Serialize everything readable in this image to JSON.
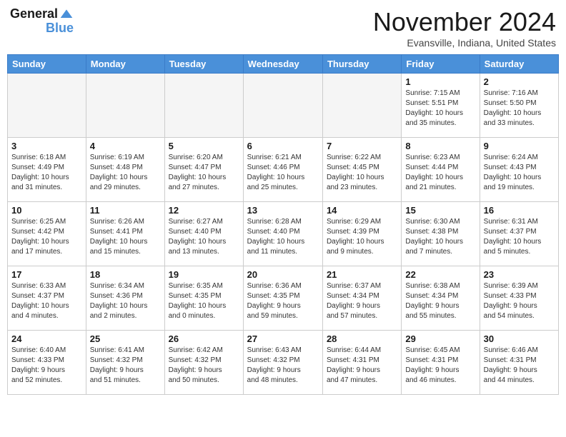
{
  "logo": {
    "line1": "General",
    "line2": "Blue"
  },
  "title": "November 2024",
  "location": "Evansville, Indiana, United States",
  "days_of_week": [
    "Sunday",
    "Monday",
    "Tuesday",
    "Wednesday",
    "Thursday",
    "Friday",
    "Saturday"
  ],
  "weeks": [
    [
      {
        "day": "",
        "info": ""
      },
      {
        "day": "",
        "info": ""
      },
      {
        "day": "",
        "info": ""
      },
      {
        "day": "",
        "info": ""
      },
      {
        "day": "",
        "info": ""
      },
      {
        "day": "1",
        "info": "Sunrise: 7:15 AM\nSunset: 5:51 PM\nDaylight: 10 hours\nand 35 minutes."
      },
      {
        "day": "2",
        "info": "Sunrise: 7:16 AM\nSunset: 5:50 PM\nDaylight: 10 hours\nand 33 minutes."
      }
    ],
    [
      {
        "day": "3",
        "info": "Sunrise: 6:18 AM\nSunset: 4:49 PM\nDaylight: 10 hours\nand 31 minutes."
      },
      {
        "day": "4",
        "info": "Sunrise: 6:19 AM\nSunset: 4:48 PM\nDaylight: 10 hours\nand 29 minutes."
      },
      {
        "day": "5",
        "info": "Sunrise: 6:20 AM\nSunset: 4:47 PM\nDaylight: 10 hours\nand 27 minutes."
      },
      {
        "day": "6",
        "info": "Sunrise: 6:21 AM\nSunset: 4:46 PM\nDaylight: 10 hours\nand 25 minutes."
      },
      {
        "day": "7",
        "info": "Sunrise: 6:22 AM\nSunset: 4:45 PM\nDaylight: 10 hours\nand 23 minutes."
      },
      {
        "day": "8",
        "info": "Sunrise: 6:23 AM\nSunset: 4:44 PM\nDaylight: 10 hours\nand 21 minutes."
      },
      {
        "day": "9",
        "info": "Sunrise: 6:24 AM\nSunset: 4:43 PM\nDaylight: 10 hours\nand 19 minutes."
      }
    ],
    [
      {
        "day": "10",
        "info": "Sunrise: 6:25 AM\nSunset: 4:42 PM\nDaylight: 10 hours\nand 17 minutes."
      },
      {
        "day": "11",
        "info": "Sunrise: 6:26 AM\nSunset: 4:41 PM\nDaylight: 10 hours\nand 15 minutes."
      },
      {
        "day": "12",
        "info": "Sunrise: 6:27 AM\nSunset: 4:40 PM\nDaylight: 10 hours\nand 13 minutes."
      },
      {
        "day": "13",
        "info": "Sunrise: 6:28 AM\nSunset: 4:40 PM\nDaylight: 10 hours\nand 11 minutes."
      },
      {
        "day": "14",
        "info": "Sunrise: 6:29 AM\nSunset: 4:39 PM\nDaylight: 10 hours\nand 9 minutes."
      },
      {
        "day": "15",
        "info": "Sunrise: 6:30 AM\nSunset: 4:38 PM\nDaylight: 10 hours\nand 7 minutes."
      },
      {
        "day": "16",
        "info": "Sunrise: 6:31 AM\nSunset: 4:37 PM\nDaylight: 10 hours\nand 5 minutes."
      }
    ],
    [
      {
        "day": "17",
        "info": "Sunrise: 6:33 AM\nSunset: 4:37 PM\nDaylight: 10 hours\nand 4 minutes."
      },
      {
        "day": "18",
        "info": "Sunrise: 6:34 AM\nSunset: 4:36 PM\nDaylight: 10 hours\nand 2 minutes."
      },
      {
        "day": "19",
        "info": "Sunrise: 6:35 AM\nSunset: 4:35 PM\nDaylight: 10 hours\nand 0 minutes."
      },
      {
        "day": "20",
        "info": "Sunrise: 6:36 AM\nSunset: 4:35 PM\nDaylight: 9 hours\nand 59 minutes."
      },
      {
        "day": "21",
        "info": "Sunrise: 6:37 AM\nSunset: 4:34 PM\nDaylight: 9 hours\nand 57 minutes."
      },
      {
        "day": "22",
        "info": "Sunrise: 6:38 AM\nSunset: 4:34 PM\nDaylight: 9 hours\nand 55 minutes."
      },
      {
        "day": "23",
        "info": "Sunrise: 6:39 AM\nSunset: 4:33 PM\nDaylight: 9 hours\nand 54 minutes."
      }
    ],
    [
      {
        "day": "24",
        "info": "Sunrise: 6:40 AM\nSunset: 4:33 PM\nDaylight: 9 hours\nand 52 minutes."
      },
      {
        "day": "25",
        "info": "Sunrise: 6:41 AM\nSunset: 4:32 PM\nDaylight: 9 hours\nand 51 minutes."
      },
      {
        "day": "26",
        "info": "Sunrise: 6:42 AM\nSunset: 4:32 PM\nDaylight: 9 hours\nand 50 minutes."
      },
      {
        "day": "27",
        "info": "Sunrise: 6:43 AM\nSunset: 4:32 PM\nDaylight: 9 hours\nand 48 minutes."
      },
      {
        "day": "28",
        "info": "Sunrise: 6:44 AM\nSunset: 4:31 PM\nDaylight: 9 hours\nand 47 minutes."
      },
      {
        "day": "29",
        "info": "Sunrise: 6:45 AM\nSunset: 4:31 PM\nDaylight: 9 hours\nand 46 minutes."
      },
      {
        "day": "30",
        "info": "Sunrise: 6:46 AM\nSunset: 4:31 PM\nDaylight: 9 hours\nand 44 minutes."
      }
    ]
  ]
}
